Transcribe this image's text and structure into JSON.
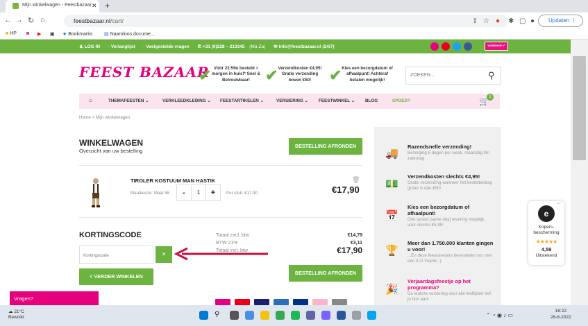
{
  "browser": {
    "tab_title": "Mijn winkelwagen - Feestbazaar",
    "url_host": "feestbazaar.nl",
    "url_path": "/cart/",
    "update_label": "Updaten",
    "bookmarks": [
      "HP",
      "Bookmarks",
      "Naamloos docume..."
    ]
  },
  "topbar": {
    "login": "LOG IN",
    "wishlist": "Verlanglijst",
    "faq": "Veelgestelde vragen",
    "phone": "+31 (0)228 – 213345",
    "phone_hours": "(Ma-Za)",
    "email": "info@feestbazaar.nl (24/7)"
  },
  "header": {
    "logo": "FEEST BAZAAR",
    "usps": [
      "Vóór 23:59u besteld = morgen in huis!* Snel & Betrouwbaar!",
      "Verzendkosten €4,95! Gratis verzending boven €50!",
      "Kies een bezorgdatum of afhaalpunt! Achteraf betalen mogelijk!"
    ],
    "search_placeholder": "ZOEKEN..."
  },
  "menu": {
    "items": [
      "THEMAFEESTEN",
      "VERKLEEDKLEDING",
      "FEESTARTIKELEN",
      "VERSIERING",
      "FEESTWINKEL",
      "BLOG",
      "SPOED?"
    ],
    "cart_count": "1"
  },
  "breadcrumb": "Home > Mijn winkelwagen",
  "cart": {
    "title": "WINKELWAGEN",
    "subtitle": "Overzicht van uw bestelling",
    "checkout_label": "BESTELLING AFRONDEN",
    "product": {
      "name": "TIROLER KOSTUUM MAN HASTIK",
      "size": "Maatkeuze: Maat 58",
      "quantity": "1",
      "per_piece": "Per stuk: €17,90",
      "price": "€17,90"
    },
    "discount": {
      "title": "KORTINGSCODE",
      "placeholder": "Kortingscode",
      "apply": ">"
    },
    "totals": {
      "excl_label": "Totaal excl. btw",
      "excl_value": "€14,79",
      "btw_label": "BTW 21%",
      "btw_value": "€3,11",
      "incl_label": "Totaal incl. btw",
      "incl_value": "€17,90"
    },
    "continue_label": "< VERDER WINKELEN",
    "checkout_label_2": "BESTELLING AFRONDEN"
  },
  "benefits": [
    {
      "title": "Razendsnelle verzending!",
      "text": "Bezorging 6 dagen per week, maandag t/m zaterdag"
    },
    {
      "title": "Verzendkosten slechts €4,95!",
      "text": "Gratis verzending wanneer het bestelbedrag groter is dan €50!"
    },
    {
      "title": "Kies een bezorgdatum of afhaalpunt!",
      "text": "Ook spoed (same day) levering mogelijk, voor slechts €5,95!"
    },
    {
      "title": "Meer dan 1.750.000 klanten gingen u voor!",
      "text": "...En deze feestvierders beoordelen ons met een 9.2! Yeahh! :)"
    },
    {
      "title": "Verjaardagsfeestje op het programma?",
      "text": "De leukste versiering voor alle leeftijden tref je hier aan!"
    }
  ],
  "trust": {
    "logo_text": "e",
    "label": "Kopers-bescherming",
    "score": "4,59",
    "verdict": "Uitstekend"
  },
  "chat": {
    "label": "Vragen?"
  },
  "taskbar": {
    "temp": "21°C",
    "weather": "Bewolkt",
    "time": "16:22",
    "date": "26-8-2022"
  },
  "colors": {
    "green": "#6cb33f",
    "pink": "#e6007e",
    "annotation_arrow": "#c8103e"
  }
}
